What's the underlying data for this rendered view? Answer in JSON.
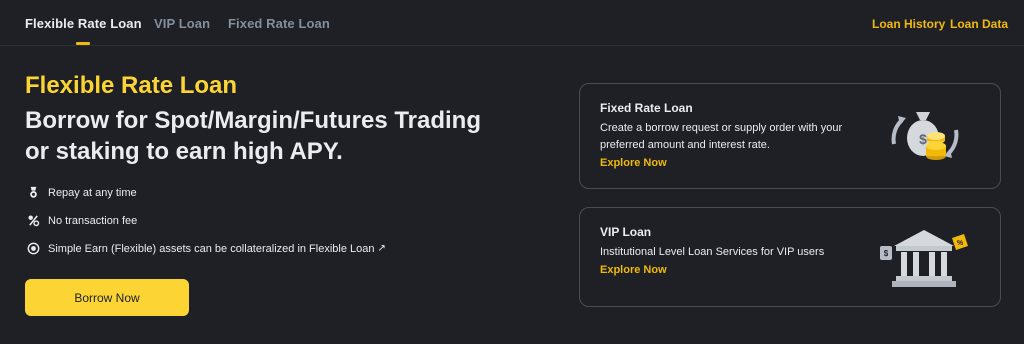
{
  "tabs": [
    {
      "label": "Flexible Rate Loan",
      "active": true
    },
    {
      "label": "VIP Loan",
      "active": false
    },
    {
      "label": "Fixed Rate Loan",
      "active": false
    }
  ],
  "top_links": {
    "loan_history": "Loan History",
    "loan_data": "Loan Data"
  },
  "hero": {
    "kicker": "Flexible Rate Loan",
    "title": "Borrow for Spot/Margin/Futures Trading or staking to earn high APY."
  },
  "features": [
    {
      "text": "Repay at any time",
      "icon": "medal-icon"
    },
    {
      "text": "No transaction fee",
      "icon": "percent-icon"
    },
    {
      "text": "Simple Earn (Flexible) assets can be collateralized in Flexible Loan",
      "icon": "coin-icon",
      "link_arrow": "↗"
    }
  ],
  "borrow_button": "Borrow Now",
  "cards": {
    "fixed": {
      "title": "Fixed Rate Loan",
      "desc": "Create a borrow request or supply order with your preferred amount and interest rate.",
      "link": "Explore Now",
      "illustration": "money-bag-coins-icon"
    },
    "vip": {
      "title": "VIP Loan",
      "desc": "Institutional Level Loan Services for VIP users",
      "link": "Explore Now",
      "illustration": "bank-building-icon"
    }
  },
  "colors": {
    "background": "#1e2026",
    "accent": "#fcd535",
    "link": "#f0b90b",
    "muted": "#848e9c",
    "text": "#eaecef",
    "card_border": "#474d57"
  }
}
